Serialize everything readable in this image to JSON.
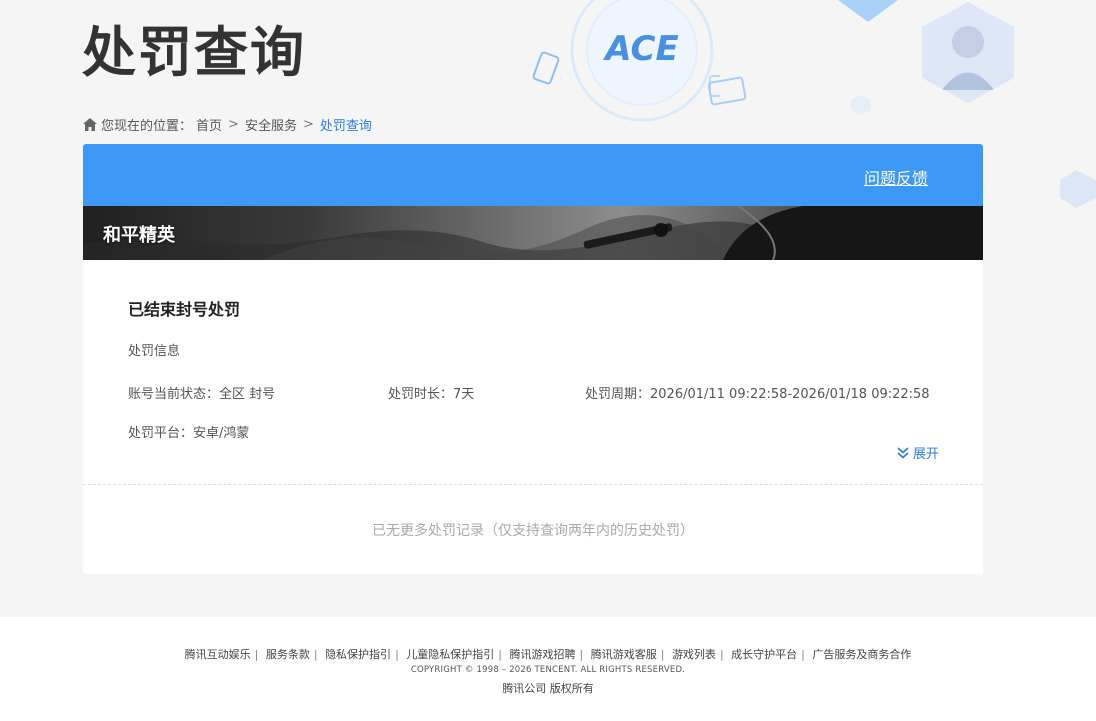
{
  "header": {
    "title": "处罚查询",
    "logo_text": "ACE"
  },
  "breadcrumb": {
    "prefix": "您现在的位置：",
    "items": [
      "首页",
      "安全服务",
      "处罚查询"
    ],
    "separator": ">"
  },
  "card": {
    "feedback_label": "问题反馈",
    "game_name": "和平精英",
    "record": {
      "title": "已结束封号处罚",
      "section_label": "处罚信息",
      "status": "账号当前状态：全区 封号",
      "duration": "处罚时长：7天",
      "period": "处罚周期：2026/01/11 09:22:58-2026/01/18 09:22:58",
      "platform": "处罚平台：安卓/鸿蒙",
      "expand_label": "展开"
    },
    "no_more_text": "已无更多处罚记录（仅支持查询两年内的历史处罚）"
  },
  "footer": {
    "links": [
      "腾讯互动娱乐",
      "服务条款",
      "隐私保护指引",
      "儿童隐私保护指引",
      "腾讯游戏招聘",
      "腾讯游戏客服",
      "游戏列表",
      "成长守护平台",
      "广告服务及商务合作"
    ],
    "copyright": "COPYRIGHT © 1998 – 2026 TENCENT. ALL RIGHTS RESERVED.",
    "company": "腾讯公司 版权所有"
  },
  "colors": {
    "accent_blue": "#3d99f5",
    "link_blue": "#2c7fd6",
    "background": "#f5f5f6"
  }
}
